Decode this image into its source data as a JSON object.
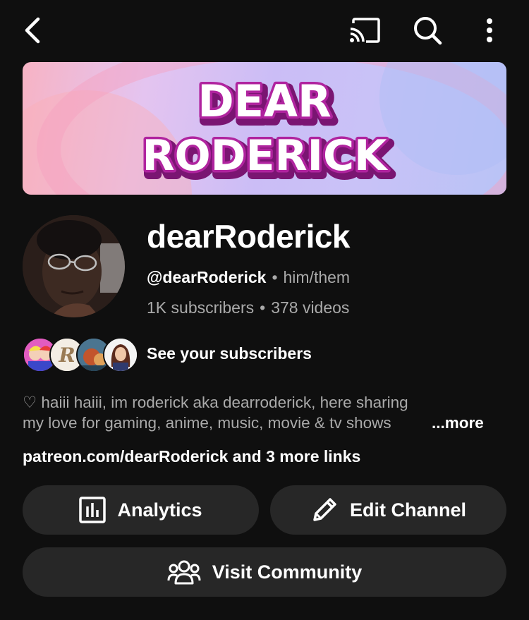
{
  "topbar": {
    "back": "back-icon",
    "cast": "cast-icon",
    "search": "search-icon",
    "more": "more-vertical-icon"
  },
  "banner": {
    "line1": "DEAR",
    "line2": "RODERICK"
  },
  "channel": {
    "name": "dearRoderick",
    "handle": "@dearRoderick",
    "pronouns": "him/them",
    "subscribers": "1K subscribers",
    "videos": "378 videos"
  },
  "subscribers_row": {
    "label": "See your subscribers"
  },
  "description": {
    "line1": "♡ haiii haiii, im roderick aka dearroderick, here sharing",
    "line2": "my love for gaming, anime, music, movie & tv shows",
    "more": "...more"
  },
  "links": {
    "text": "patreon.com/dearRoderick and 3 more links"
  },
  "buttons": {
    "analytics": "Analytics",
    "edit_channel": "Edit Channel",
    "visit_community": "Visit Community"
  },
  "colors": {
    "background": "#0f0f0f",
    "pill": "#272727",
    "secondary_text": "#aaaaaa",
    "banner_text_fill": "#ffffff",
    "banner_text_outline": "#9b1f8f"
  }
}
